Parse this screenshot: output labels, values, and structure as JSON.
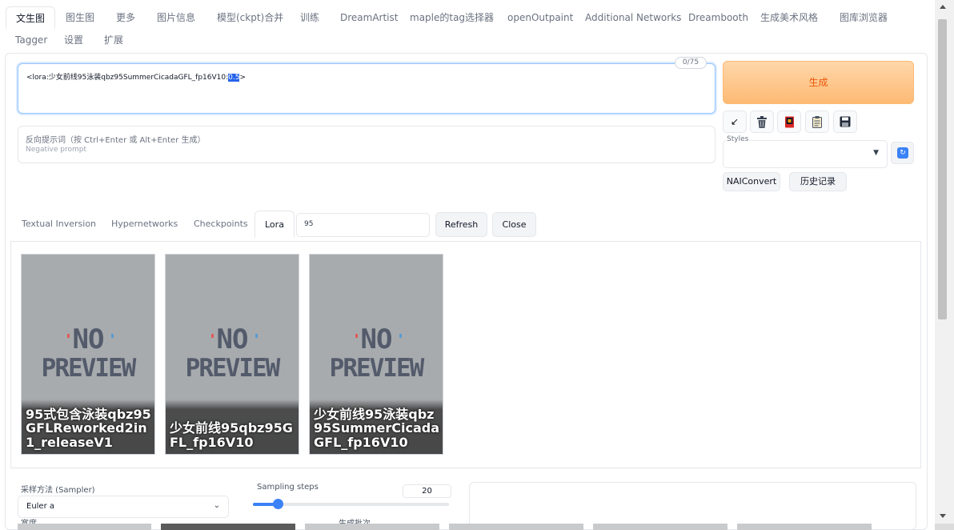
{
  "top_tabs": [
    {
      "label": "文生图",
      "active": true
    },
    {
      "label": "图生图"
    },
    {
      "label": "更多"
    },
    {
      "label": "图片信息"
    },
    {
      "label": "模型(ckpt)合并"
    },
    {
      "label": "训练"
    },
    {
      "label": "DreamArtist"
    },
    {
      "label": "maple的tag选择器"
    },
    {
      "label": "openOutpaint"
    },
    {
      "label": "Additional Networks"
    },
    {
      "label": "Dreambooth"
    },
    {
      "label": "生成美术风格"
    },
    {
      "label": "图库浏览器"
    },
    {
      "label": "Tagger"
    },
    {
      "label": "设置"
    },
    {
      "label": "扩展"
    }
  ],
  "prompt": {
    "text_before": "<lora:少女前线95泳装qbz95SummerCicadaGFL_fp16V10:",
    "text_selected": "0.5",
    "text_after": ">",
    "token_count": "0/75"
  },
  "negative_prompt": {
    "placeholder_line1": "反向提示词（按 Ctrl+Enter 或 Alt+Enter 生成）",
    "placeholder_line2": "Negative prompt"
  },
  "generate": {
    "label": "生成"
  },
  "tools": {
    "paste_icon": "↙",
    "trash_icon": "trash-icon",
    "model_icon": "red-book-icon",
    "clipboard_icon": "clipboard-icon",
    "save_icon": "floppy-disk-icon"
  },
  "styles": {
    "label": "Styles",
    "value": ""
  },
  "buttons": {
    "naiconvert": "NAIConvert",
    "history": "历史记录"
  },
  "extra_networks": {
    "tabs": [
      {
        "label": "Textual Inversion"
      },
      {
        "label": "Hypernetworks"
      },
      {
        "label": "Checkpoints"
      },
      {
        "label": "Lora",
        "active": true
      }
    ],
    "search_value": "95",
    "refresh_label": "Refresh",
    "close_label": "Close",
    "no_preview_line1": "NO",
    "no_preview_line2": "PREVIEW",
    "cards": [
      {
        "title": "95式包含泳装qbz95GFLReworked2in1_releaseV1"
      },
      {
        "title": "少女前线95qbz95GFL_fp16V10"
      },
      {
        "title": "少女前线95泳装qbz95SummerCicadaGFL_fp16V10"
      }
    ]
  },
  "settings": {
    "sampler_label": "采样方法 (Sampler)",
    "sampler_value": "Euler a",
    "steps_label": "Sampling steps",
    "steps_value": "20",
    "steps_min": 1,
    "steps_max": 150,
    "width_label_cut": "宽度",
    "batch_label_cut": "生成批次"
  },
  "colors": {
    "generate_bg": "#fdba74",
    "generate_text": "#ea580c",
    "accent": "#3b82f6",
    "selection": "#2563eb"
  }
}
